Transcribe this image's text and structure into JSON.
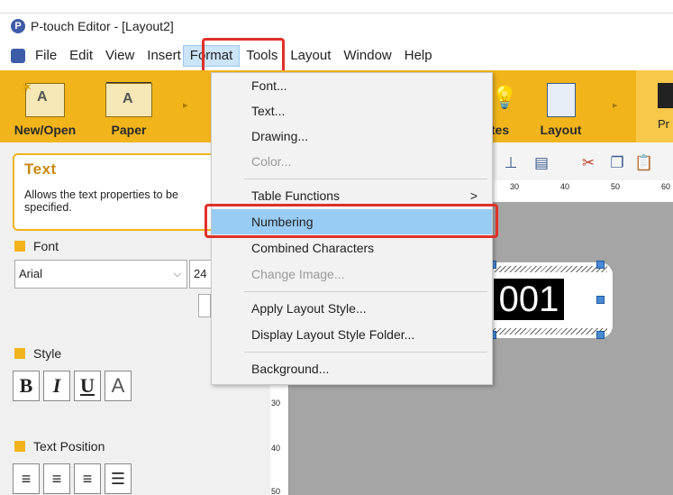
{
  "caption_text": "",
  "window": {
    "title": "P-touch Editor - [Layout2]",
    "app_icon": "P"
  },
  "menubar": {
    "items": [
      "File",
      "Edit",
      "View",
      "Insert",
      "Format",
      "Tools",
      "Layout",
      "Window",
      "Help"
    ],
    "active": "Format"
  },
  "ribbon": {
    "color": "#f1b41b",
    "buttons": [
      {
        "label": "New/Open",
        "icon": "new-open-icon"
      },
      {
        "label": "Paper",
        "icon": "paper-icon"
      },
      {
        "label": "tes",
        "icon": "templates-icon"
      },
      {
        "label": "Layout",
        "icon": "layout-icon"
      },
      {
        "label": "Pr",
        "icon": "print-icon"
      }
    ]
  },
  "format_menu": {
    "items": [
      {
        "label": "Font...",
        "enabled": true
      },
      {
        "label": "Text...",
        "enabled": true
      },
      {
        "label": "Drawing...",
        "enabled": true
      },
      {
        "label": "Color...",
        "enabled": false
      },
      {
        "label": "Table Functions",
        "enabled": true,
        "submenu": true
      },
      {
        "label": "Numbering",
        "enabled": true,
        "highlighted": true
      },
      {
        "label": "Combined Characters",
        "enabled": true
      },
      {
        "label": "Change Image...",
        "enabled": false
      },
      {
        "label": "Apply Layout Style...",
        "enabled": true
      },
      {
        "label": "Display Layout Style Folder...",
        "enabled": true
      },
      {
        "label": "Background...",
        "enabled": true
      }
    ],
    "submenu_arrow": ">"
  },
  "properties": {
    "title": "Text",
    "description": "Allows the text properties to be specified.",
    "font_header": "Font",
    "font_value": "Arial",
    "size_value": "24",
    "style_header": "Style",
    "style_buttons": [
      "B",
      "I",
      "U",
      "A"
    ],
    "position_header": "Text Position"
  },
  "rulers": {
    "horizontal": [
      "30",
      "40",
      "50",
      "60"
    ],
    "vertical": [
      "30",
      "40",
      "50"
    ]
  },
  "label": {
    "text": "001"
  },
  "highlight_color": "#e0302a"
}
